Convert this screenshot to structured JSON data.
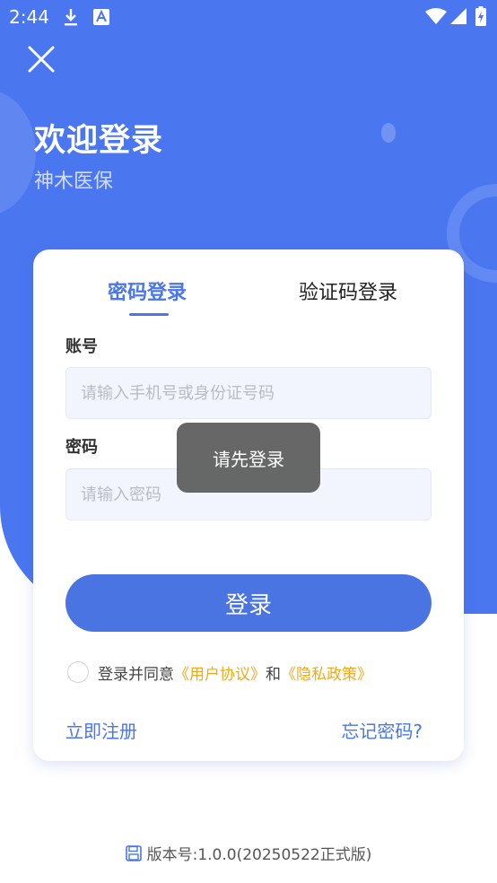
{
  "status_bar": {
    "time": "2:44",
    "left_icons": [
      "download-icon",
      "a-notification-icon"
    ],
    "right_icons": [
      "wifi-icon",
      "signal-icon",
      "battery-icon"
    ]
  },
  "header": {
    "title": "欢迎登录",
    "subtitle": "神木医保"
  },
  "tabs": [
    {
      "label": "密码登录",
      "active": true
    },
    {
      "label": "验证码登录",
      "active": false
    }
  ],
  "form": {
    "account_label": "账号",
    "account_placeholder": "请输入手机号或身份证号码",
    "account_value": "",
    "password_label": "密码",
    "password_placeholder": "请输入密码",
    "password_value": ""
  },
  "login_button": "登录",
  "agreement": {
    "checked": false,
    "prefix": "登录并同意",
    "user_agreement": "《用户协议》",
    "conjunction": "和",
    "privacy_policy": "《隐私政策》"
  },
  "links": {
    "register": "立即注册",
    "forgot_password": "忘记密码?"
  },
  "toast": "请先登录",
  "version": "版本号:1.0.0(20250522正式版)",
  "colors": {
    "primary": "#4a76f0",
    "button": "#4a74e2",
    "link_accent": "#f2a818",
    "input_bg": "#f2f5fd"
  }
}
